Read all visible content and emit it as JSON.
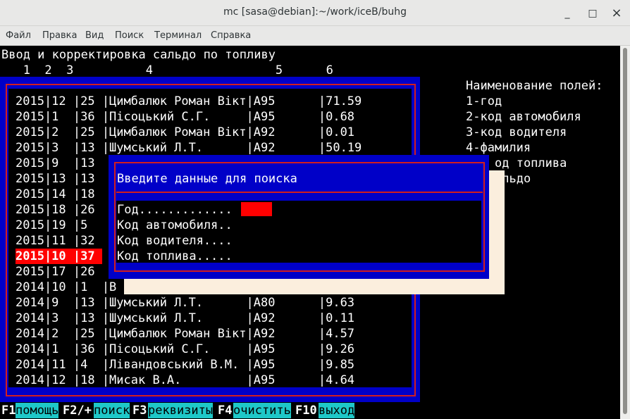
{
  "window": {
    "title": "mc [sasa@debian]:~/work/iceB/buhg",
    "minimize": "_",
    "maximize": "□",
    "close": "×"
  },
  "menu": [
    "Файл",
    "Правка",
    "Вид",
    "Поиск",
    "Терминал",
    "Справка"
  ],
  "screen": {
    "heading": "Ввод и корректировка сальдо по топливу",
    "column_numbers": "   1  2  3          4                 5      6"
  },
  "rows": [
    "2015|12 |25 |Цимбалюк Роман Вікт|A95      |71.59",
    "2015|1  |36 |Пісоцький С.Г.     |A95      |0.68",
    "2015|2  |25 |Цимбалюк Роман Вікт|A92      |0.01",
    "2015|3  |13 |Шумський Л.Т.      |A92      |50.19",
    "2015|9  |13 ",
    "2015|13 |13 ",
    "2015|14 |18 ",
    "2015|18 |26 ",
    "2015|19 |5  ",
    "2015|11 |32 ",
    "2015|10 |37 ",
    "2015|17 |26 ",
    "2014|10 |1  |В",
    "2014|9  |13 |Шумський Л.Т.      |A80      |9.63",
    "2014|3  |13 |Шумський Л.Т.      |A92      |0.11",
    "2014|2  |25 |Цимбалюк Роман Вікт|A92      |4.57",
    "2014|1  |36 |Пісоцький С.Г.     |A95      |9.26",
    "2014|11 |4  |Лівандовський В.М. |A95      |9.85",
    "2014|12 |18 |Мисак В.А.         |A95      |4.64"
  ],
  "highlight_row_index": 10,
  "legend": {
    "title": "Наименование полей:",
    "items": [
      "1-год",
      "2-код автомобиля",
      "3-код водителя",
      "4-фамилия",
      "од топлива",
      "альдо"
    ]
  },
  "dialog": {
    "title": "Введите данные для поиска",
    "fields": [
      "Год.............",
      "Код автомобиля..",
      "Код водителя....",
      "Код топлива....."
    ]
  },
  "fkeys": [
    {
      "key": "F1",
      "label": "помощь"
    },
    {
      "key": "F2/+",
      "label": "поиск"
    },
    {
      "key": "F3",
      "label": "реквизиты"
    },
    {
      "key": "F4",
      "label": "очистить"
    },
    {
      "key": "F10",
      "label": "выход"
    }
  ],
  "colors": {
    "panel_blue": "#0000c8",
    "frame_red": "#d21e1e",
    "highlight": "#ff0000",
    "fkey_label": "#1ec8c8",
    "dialog_shadow": "#fbeedd"
  }
}
